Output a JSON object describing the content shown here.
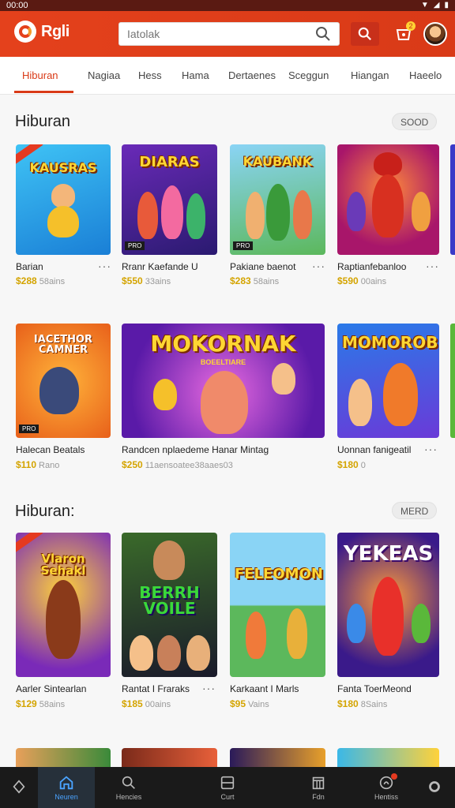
{
  "status": {
    "time": "00:00"
  },
  "header": {
    "logo_text": "Rgli",
    "search_placeholder": "Iatolak",
    "cart_badge": "2",
    "accent": "#e4411c"
  },
  "tabs": [
    {
      "label": "Hiburan"
    },
    {
      "label": "Nagiaa"
    },
    {
      "label": "Hess"
    },
    {
      "label": "Hama"
    },
    {
      "label": "Dertaenes"
    },
    {
      "label": "Sceggun"
    },
    {
      "label": "Hiangan"
    },
    {
      "label": "Haeelo"
    }
  ],
  "sections": [
    {
      "title": "Hiburan",
      "pill": "SOOD",
      "cards": [
        {
          "art_title": "KAUSRAS",
          "name": "Barian",
          "price": "$288",
          "meta": "58ains"
        },
        {
          "art_title": "DIARAS",
          "name": "Rranr Kaefande U",
          "price": "$550",
          "meta": "33ains"
        },
        {
          "art_title": "KAUBANK",
          "name": "Pakiane baenot",
          "price": "$283",
          "meta": "58ains"
        },
        {
          "art_title": "",
          "name": "Raptianfebanloo",
          "price": "$590",
          "meta": "00ains"
        }
      ]
    },
    {
      "title": "",
      "pill": "",
      "cards": [
        {
          "art_title": "IACETHOR CAMNER",
          "name": "Halecan Beatals",
          "price": "$110",
          "meta": "Rano"
        },
        {
          "art_title": "MOKORNAK",
          "art_sub": "BOEELTIARE",
          "name": "Randcen nplaedeme Hanar Mintag",
          "price": "$250",
          "meta": "11aensoatee38aaes03"
        },
        {
          "art_title": "MOMOROB",
          "name": "Uonnan fanigeatil",
          "price": "$180",
          "meta": "0"
        }
      ]
    },
    {
      "title": "Hiburan:",
      "pill": "MERD",
      "cards": [
        {
          "art_title": "Vlaron Sehakl",
          "name": "Aarler Sintearlan",
          "price": "$129",
          "meta": "58ains"
        },
        {
          "art_title": "BERRH VOILE",
          "name": "Rantat I Fraraks",
          "price": "$185",
          "meta": "00ains"
        },
        {
          "art_title": "FELEOMON",
          "name": "Karkaant I Marls",
          "price": "$95",
          "meta": "Vains"
        },
        {
          "art_title": "YEKEAS",
          "name": "Fanta ToerMeond",
          "price": "$180",
          "meta": "8Sains"
        }
      ]
    }
  ],
  "bottom_nav": [
    {
      "label": "",
      "icon": "diamond-icon"
    },
    {
      "label": "Neuren",
      "icon": "home-icon"
    },
    {
      "label": "Hencies",
      "icon": "search-icon"
    },
    {
      "label": "Curt",
      "icon": "card-icon"
    },
    {
      "label": "Fdn",
      "icon": "calendar-icon"
    },
    {
      "label": "Hentiss",
      "icon": "gift-icon"
    },
    {
      "label": "",
      "icon": "circle-icon"
    }
  ]
}
